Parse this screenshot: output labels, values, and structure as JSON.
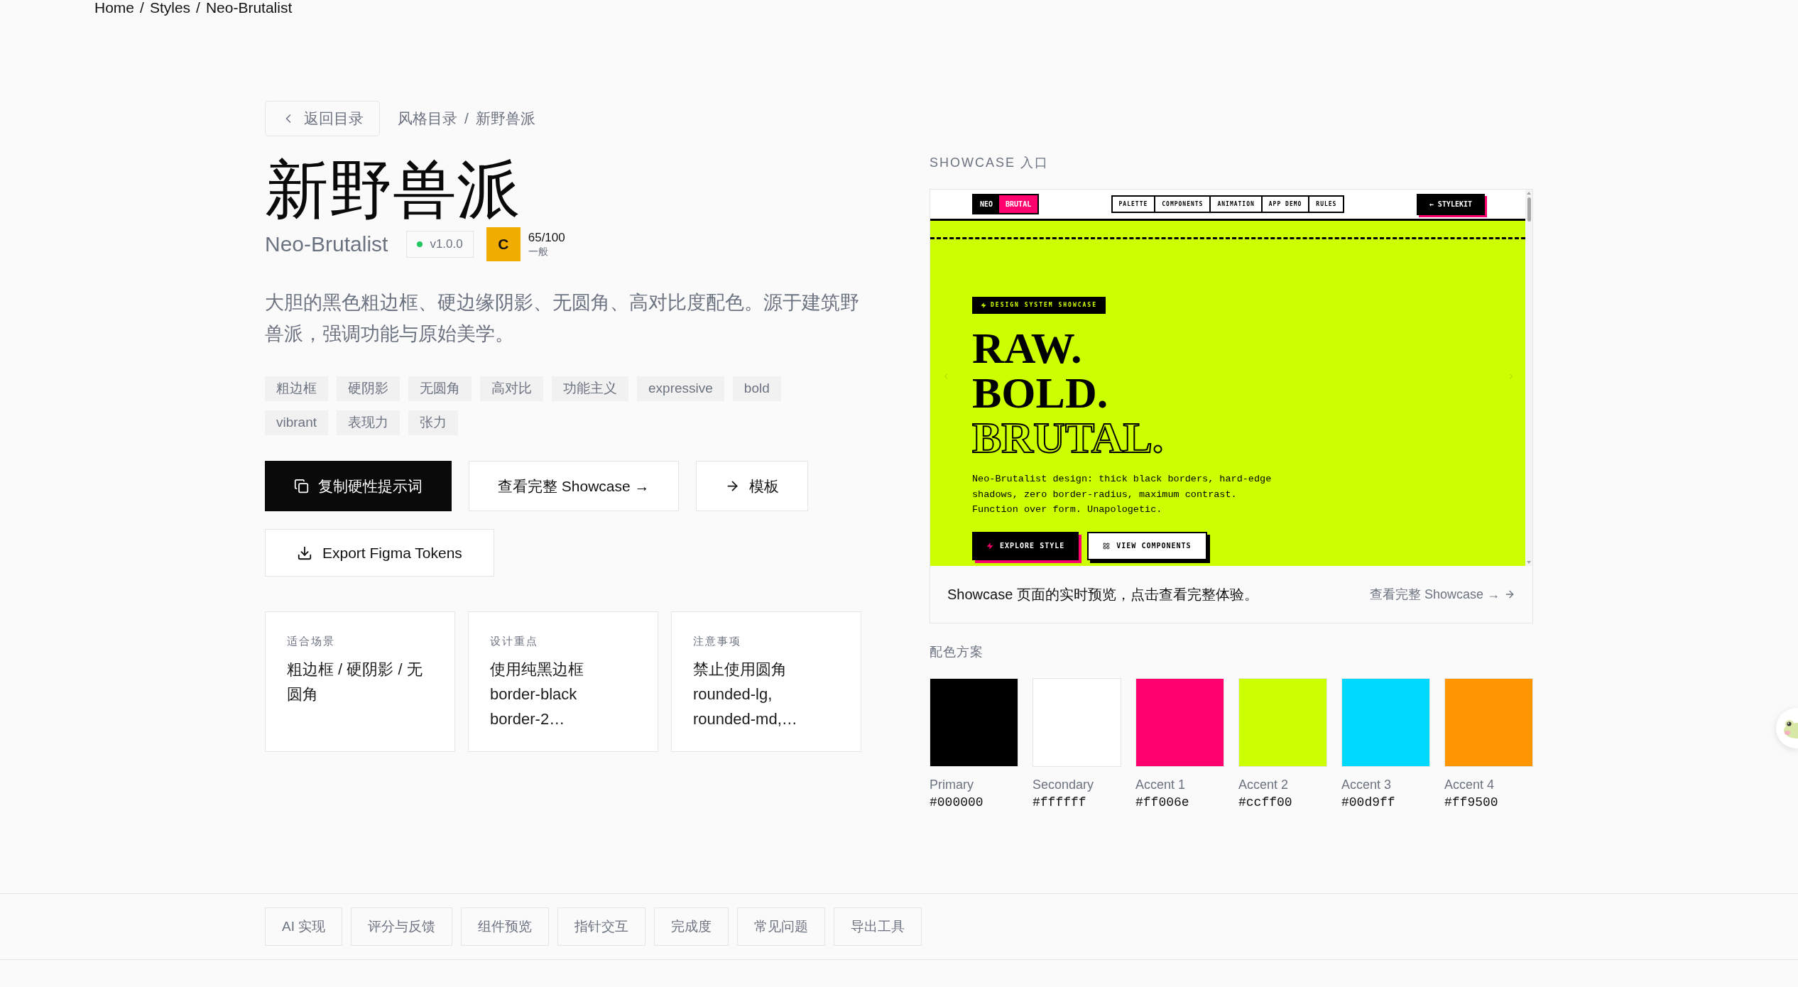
{
  "breadcrumb": {
    "items": [
      "Home",
      "Styles",
      "Neo-Brutalist"
    ],
    "separators": [
      "/",
      "/"
    ]
  },
  "back_button": {
    "label": "返回目录"
  },
  "path": {
    "items": [
      "风格目录",
      "新野兽派"
    ],
    "separators": [
      "/"
    ]
  },
  "title": "新野兽派",
  "subtitle": "Neo-Brutalist",
  "version": "v1.0.0",
  "score": {
    "grade": "C",
    "value": "65/100",
    "rating": "一般"
  },
  "description": "大胆的黑色粗边框、硬边缘阴影、无圆角、高对比度配色。源于建筑野兽派，强调功能与原始美学。",
  "tags": [
    "粗边框",
    "硬阴影",
    "无圆角",
    "高对比",
    "功能主义",
    "expressive",
    "bold",
    "vibrant",
    "表现力",
    "张力"
  ],
  "actions": [
    {
      "label": "复制硬性提示词",
      "kind": "primary"
    },
    {
      "label": "查看完整 Showcase →",
      "kind": "secondary"
    },
    {
      "label": "模板",
      "kind": "secondary"
    }
  ],
  "export_button": {
    "label": "Export Figma Tokens"
  },
  "cards": [
    {
      "label": "适合场景",
      "text": "粗边框 / 硬阴影 / 无圆角"
    },
    {
      "label": "设计重点",
      "text": "使用纯黑边框 border-black border-2…"
    },
    {
      "label": "注意事项",
      "text": "禁止使用圆角 rounded-lg, rounded-md,…"
    }
  ],
  "showcase": {
    "heading": "SHOWCASE 入口",
    "preview": {
      "logo": [
        {
          "text": "NEO",
          "color": "#000000"
        },
        {
          "text": "BRUTAL",
          "color": "#ff006e"
        }
      ],
      "nav": [
        "PALETTE",
        "COMPONENTS",
        "ANIMATION",
        "APP DEMO",
        "RULES"
      ],
      "back_link": "← STYLEKIT",
      "badge": "DESIGN SYSTEM SHOWCASE",
      "headline": [
        {
          "text": "RAW.",
          "kind": "solid"
        },
        {
          "text": "BOLD.",
          "kind": "solid"
        },
        {
          "text": "BRUTAL.",
          "kind": "outline"
        }
      ],
      "description": "Neo-Brutalist design: thick black borders, hard-edge shadows, zero border-radius, maximum contrast. Function over form. Unapologetic.",
      "buttons": [
        {
          "label": "EXPLORE STYLE",
          "kind": "primary"
        },
        {
          "label": "VIEW COMPONENTS",
          "kind": "secondary"
        }
      ]
    },
    "caption": "Showcase 页面的实时预览，点击查看完整体验。",
    "link": "查看完整 Showcase →"
  },
  "palette": {
    "heading": "配色方案",
    "colors": [
      {
        "name": "Primary",
        "hex": "#000000",
        "color": "#000000"
      },
      {
        "name": "Secondary",
        "hex": "#ffffff",
        "color": "#ffffff"
      },
      {
        "name": "Accent 1",
        "hex": "#ff006e",
        "color": "#ff006e"
      },
      {
        "name": "Accent 2",
        "hex": "#ccff00",
        "color": "#ccff00"
      },
      {
        "name": "Accent 3",
        "hex": "#00d9ff",
        "color": "#00d9ff"
      },
      {
        "name": "Accent 4",
        "hex": "#ff9500",
        "color": "#ff9500"
      }
    ]
  },
  "section_tabs": [
    "AI 实现",
    "评分与反馈",
    "组件预览",
    "指针交互",
    "完成度",
    "常见问题",
    "导出工具"
  ]
}
